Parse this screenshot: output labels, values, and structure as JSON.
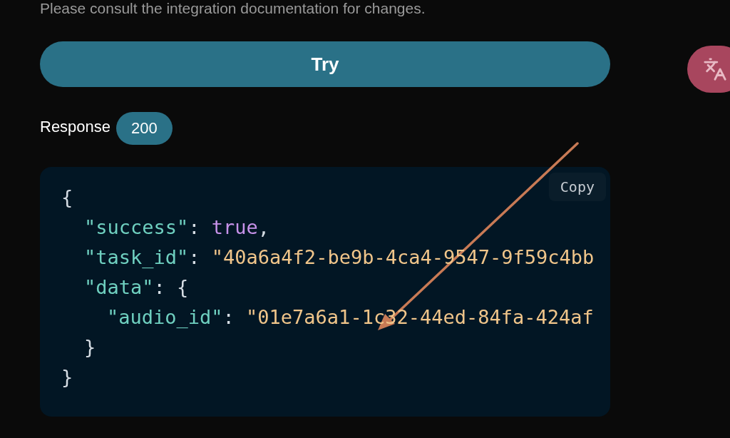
{
  "notice": "Please consult the integration documentation for changes.",
  "try_button": "Try",
  "response": {
    "label": "Response",
    "status": "200"
  },
  "code_block": {
    "copy_button": "Copy",
    "lines": [
      {
        "tokens": [
          {
            "kind": "punct",
            "text": "{"
          }
        ],
        "children": [
          {
            "tokens": [
              {
                "kind": "key",
                "text": "\"success\""
              },
              {
                "kind": "punct",
                "text": ": "
              },
              {
                "kind": "bool",
                "text": "true"
              },
              {
                "kind": "punct",
                "text": ","
              }
            ]
          },
          {
            "tokens": [
              {
                "kind": "key",
                "text": "\"task_id\""
              },
              {
                "kind": "punct",
                "text": ": "
              },
              {
                "kind": "string",
                "text": "\"40a6a4f2-be9b-4ca4-9547-9f59c4bb"
              }
            ]
          },
          {
            "tokens": [
              {
                "kind": "key",
                "text": "\"data\""
              },
              {
                "kind": "punct",
                "text": ": {"
              }
            ],
            "children": [
              {
                "tokens": [
                  {
                    "kind": "key",
                    "text": "\"audio_id\""
                  },
                  {
                    "kind": "punct",
                    "text": ": "
                  },
                  {
                    "kind": "string",
                    "text": "\"01e7a6a1-1c32-44ed-84fa-424af"
                  }
                ]
              }
            ]
          },
          {
            "tokens": [
              {
                "kind": "punct",
                "text": "}"
              }
            ]
          }
        ]
      },
      {
        "tokens": [
          {
            "kind": "punct",
            "text": "}"
          }
        ]
      }
    ]
  }
}
